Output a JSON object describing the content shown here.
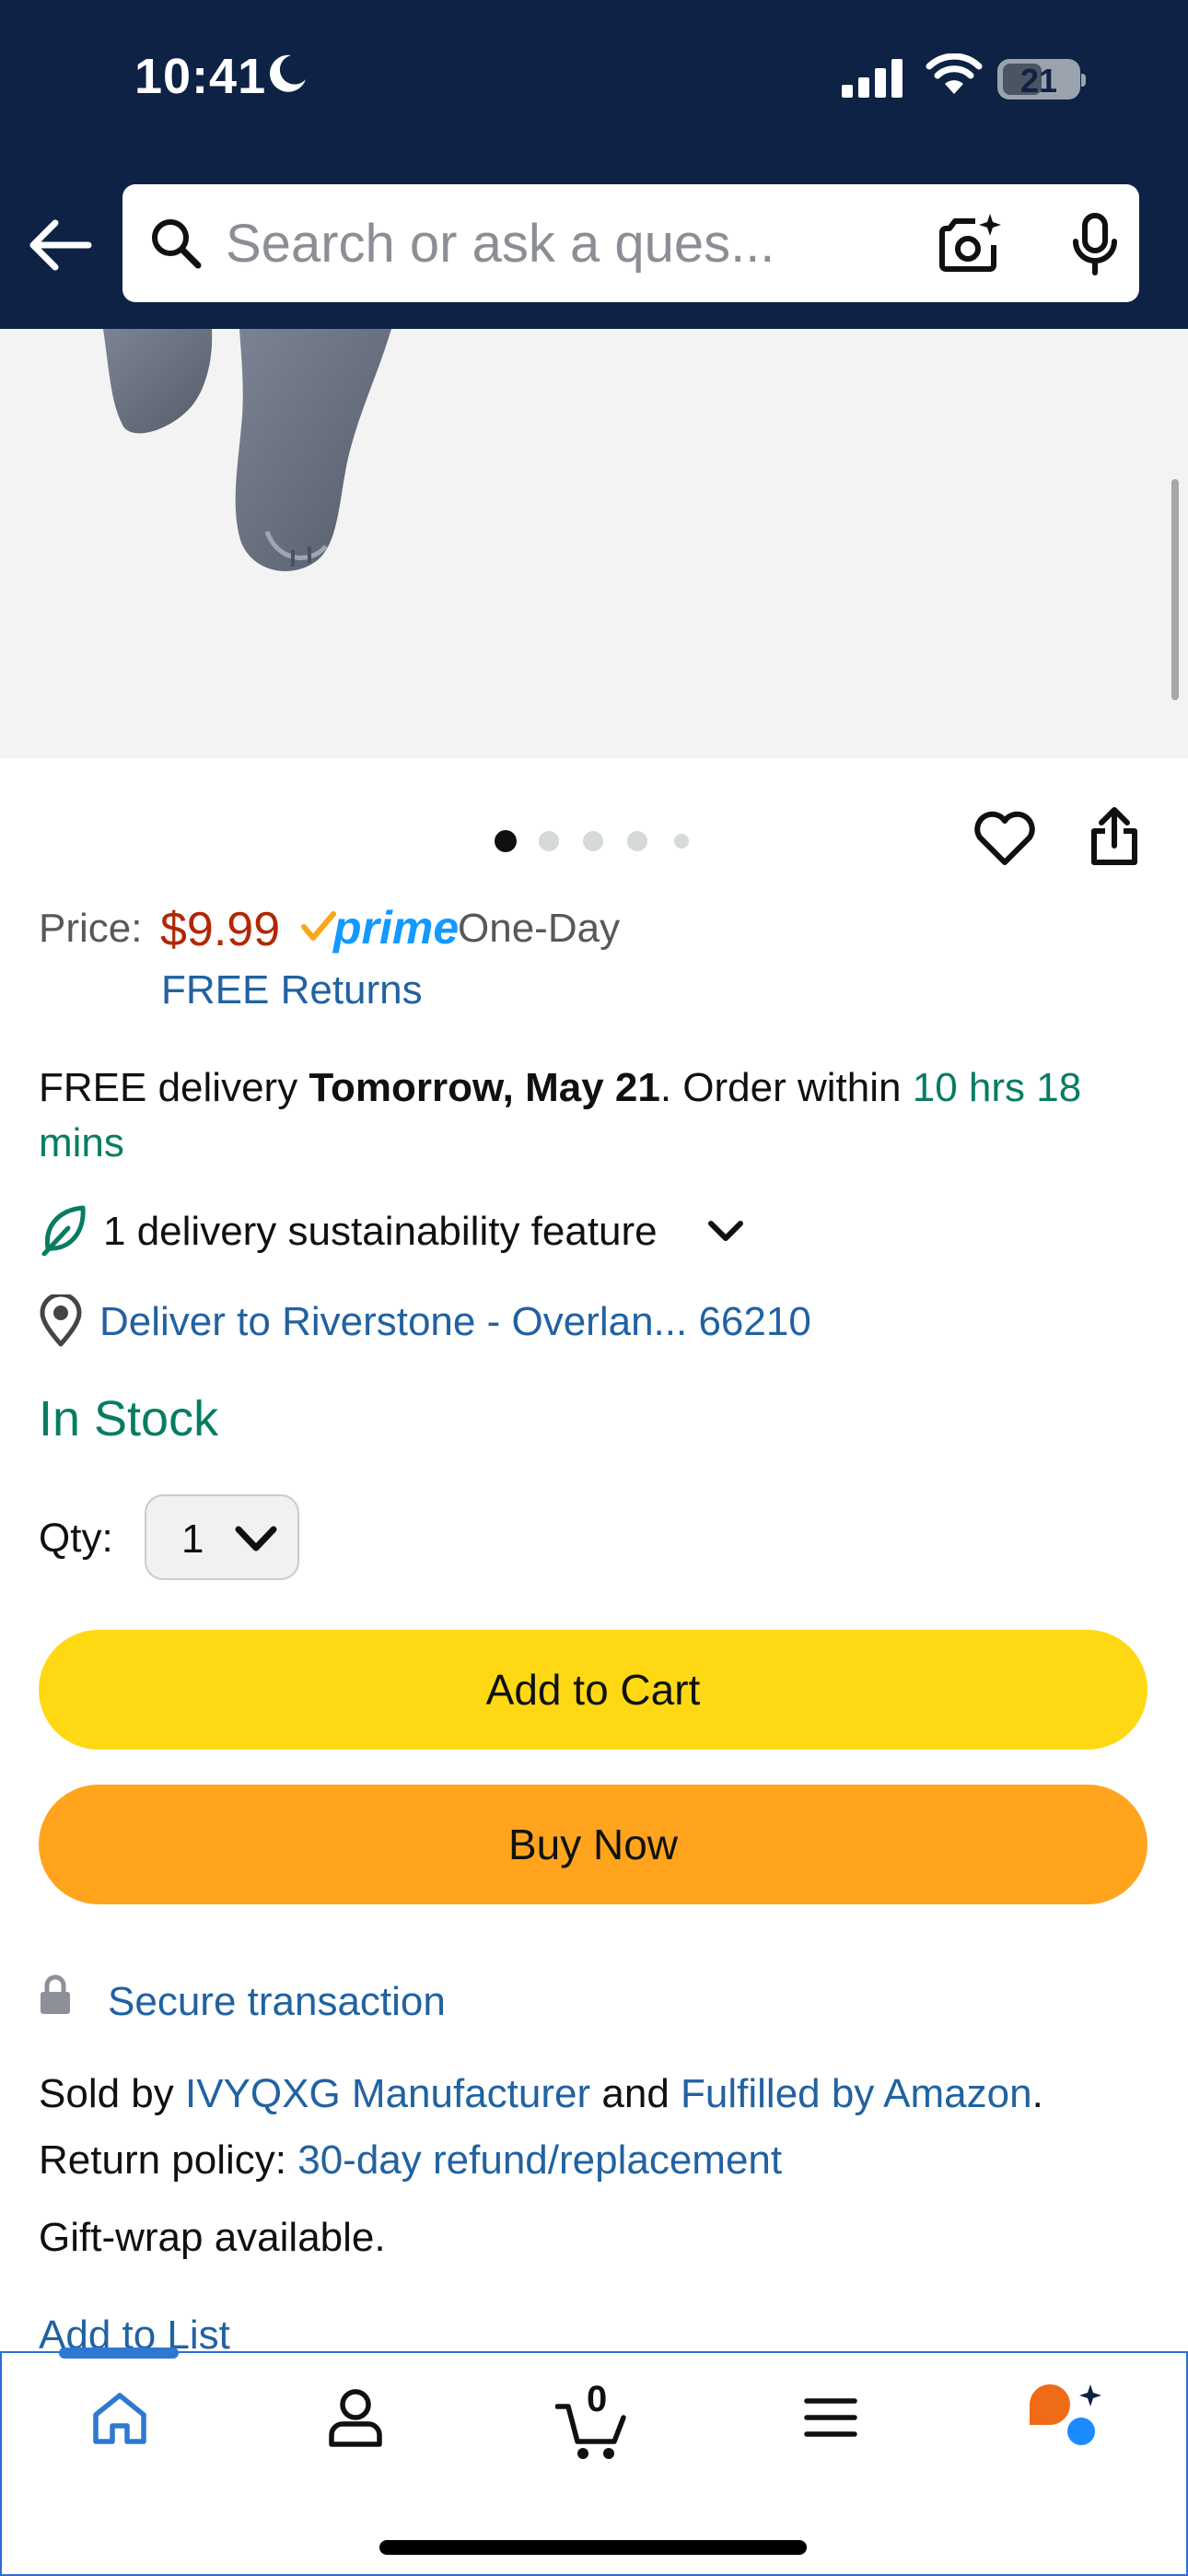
{
  "status_bar": {
    "time": "10:41",
    "battery": "21"
  },
  "search": {
    "placeholder": "Search or ask a ques..."
  },
  "gallery": {
    "dot_count": 5,
    "active_index": 0
  },
  "price": {
    "label": "Price:",
    "amount": "$9.99",
    "prime": "prime",
    "speed": "One-Day",
    "returns": "FREE Returns"
  },
  "delivery": {
    "prefix": "FREE delivery ",
    "date": "Tomorrow, May 21",
    "mid": ". Order within ",
    "countdown_line1": "10 hrs 18",
    "countdown_line2": "mins"
  },
  "sustainability": {
    "label": "1 delivery sustainability feature"
  },
  "location": {
    "label": "Deliver to Riverstone - Overlan... 66210"
  },
  "stock": {
    "status": "In Stock"
  },
  "qty": {
    "label": "Qty:",
    "value": "1"
  },
  "buttons": {
    "add_to_cart": "Add to Cart",
    "buy_now": "Buy Now"
  },
  "secure": {
    "label": "Secure transaction"
  },
  "seller": {
    "sold_by": "Sold by ",
    "seller_name": "IVYQXG Manufacturer",
    "and": " and ",
    "fulfilled": "Fulfilled by Amazon",
    "period": "."
  },
  "returns": {
    "label": "Return policy: ",
    "link": "30-day refund/replacement"
  },
  "gift": {
    "label": "Gift-wrap available."
  },
  "add_to_list": "Add to List",
  "nav": {
    "cart_count": "0"
  },
  "colors": {
    "header": "#0d2244",
    "price": "#b12704",
    "link": "#2162a1",
    "stock": "#067d62",
    "add_to_cart": "#ffd814",
    "buy_now": "#ffa41c",
    "nav_active": "#2f78d2"
  },
  "icons": [
    "moon-icon",
    "signal-icon",
    "wifi-icon",
    "battery-icon",
    "back-arrow-icon",
    "search-icon",
    "camera-icon",
    "microphone-icon",
    "heart-icon",
    "share-icon",
    "leaf-icon",
    "chevron-down-icon",
    "location-pin-icon",
    "lock-icon",
    "home-icon",
    "account-icon",
    "cart-icon",
    "menu-icon",
    "rufus-icon"
  ]
}
